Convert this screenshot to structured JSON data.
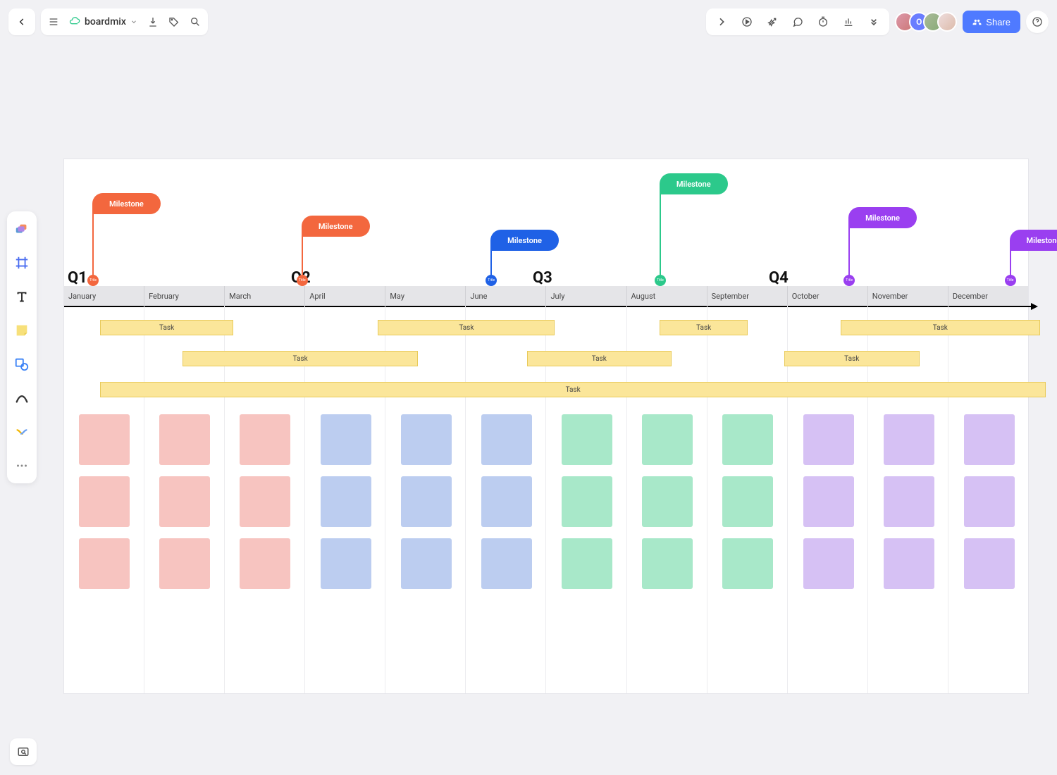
{
  "app": {
    "name": "boardmix"
  },
  "share": {
    "label": "Share"
  },
  "quarters": {
    "q1": "Q1",
    "q2": "Q2",
    "q3": "Q3",
    "q4": "Q4"
  },
  "months": [
    "January",
    "February",
    "March",
    "April",
    "May",
    "June",
    "July",
    "August",
    "September",
    "October",
    "November",
    "December"
  ],
  "milestones": [
    {
      "label": "Milestone",
      "month": 0,
      "color": "#f3673e",
      "flagTop": 48,
      "dotText": "Title"
    },
    {
      "label": "Milestone",
      "month": 2.6,
      "color": "#f3673e",
      "flagTop": 80,
      "dotText": "Title"
    },
    {
      "label": "Milestone",
      "month": 4.95,
      "color": "#1f61e6",
      "flagTop": 100,
      "dotText": "Title"
    },
    {
      "label": "Milestone",
      "month": 7.05,
      "color": "#2cc98b",
      "flagTop": 20,
      "dotText": "Title"
    },
    {
      "label": "Milestone",
      "month": 9.4,
      "color": "#9a3ff0",
      "flagTop": 68,
      "dotText": "Title"
    },
    {
      "label": "Milestone",
      "month": 11.4,
      "color": "#9a3ff0",
      "flagTop": 100,
      "dotText": "Title"
    }
  ],
  "tasks": [
    {
      "label": "Task",
      "start": 0.1,
      "end": 1.75,
      "row": 0
    },
    {
      "label": "Task",
      "start": 3.55,
      "end": 5.75,
      "row": 0
    },
    {
      "label": "Task",
      "start": 7.05,
      "end": 8.15,
      "row": 0
    },
    {
      "label": "Task",
      "start": 9.3,
      "end": 11.78,
      "row": 0
    },
    {
      "label": "Task",
      "start": 1.12,
      "end": 4.05,
      "row": 1
    },
    {
      "label": "Task",
      "start": 5.4,
      "end": 7.2,
      "row": 1
    },
    {
      "label": "Task",
      "start": 8.6,
      "end": 10.28,
      "row": 1
    },
    {
      "label": "Task",
      "start": 0.1,
      "end": 11.85,
      "row": 2
    }
  ],
  "noteColors": {
    "q1": "#f7c4c0",
    "q2": "#bccdf0",
    "q3": "#a8e8c9",
    "q4": "#d6c1f4"
  }
}
